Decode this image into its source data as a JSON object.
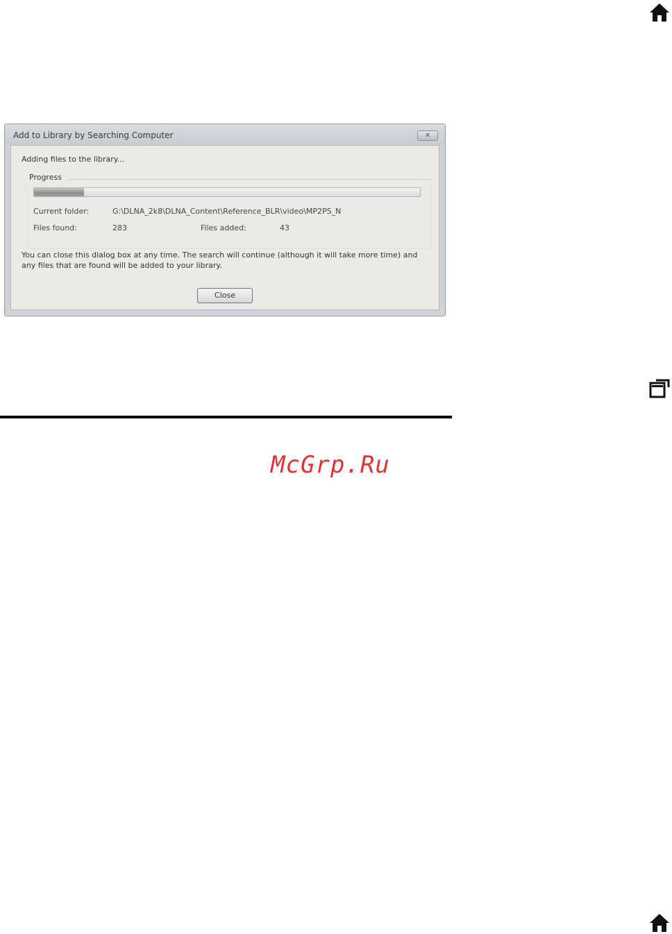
{
  "dialog": {
    "title": "Add to Library by Searching Computer",
    "close_glyph": "✕",
    "status_text": "Adding files to the library...",
    "progress_label": "Progress",
    "progress_value": 0.13,
    "current_folder_label": "Current folder:",
    "current_folder_value": "G:\\DLNA_2k8\\DLNA_Content\\Reference_BLR\\video\\MP2PS_N",
    "files_found_label": "Files found:",
    "files_found_value": "283",
    "files_added_label": "Files added:",
    "files_added_value": "43",
    "footer_text": "You can close this dialog box at any time. The search will continue (although it will take more time) and any files that are found will be added to your library.",
    "close_button_label": "Close"
  },
  "watermark": "McGrp.Ru",
  "icons": {
    "home_top": "home-icon",
    "back": "back-icon",
    "home_bottom": "home-icon"
  }
}
